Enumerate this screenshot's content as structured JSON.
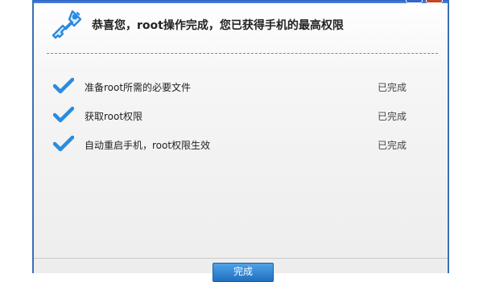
{
  "header": {
    "title": "恭喜您，root操作完成，您已获得手机的最高权限",
    "icon": "key-icon"
  },
  "steps": [
    {
      "label": "准备root所需的必要文件",
      "status": "已完成",
      "icon": "checkmark-icon"
    },
    {
      "label": "获取root权限",
      "status": "已完成",
      "icon": "checkmark-icon"
    },
    {
      "label": "自动重启手机，root权限生效",
      "status": "已完成",
      "icon": "checkmark-icon"
    }
  ],
  "footer": {
    "finish_label": "完成"
  },
  "colors": {
    "accent": "#2a8be0",
    "title_bar": "#2f63c9",
    "close_button": "#c0411f"
  }
}
